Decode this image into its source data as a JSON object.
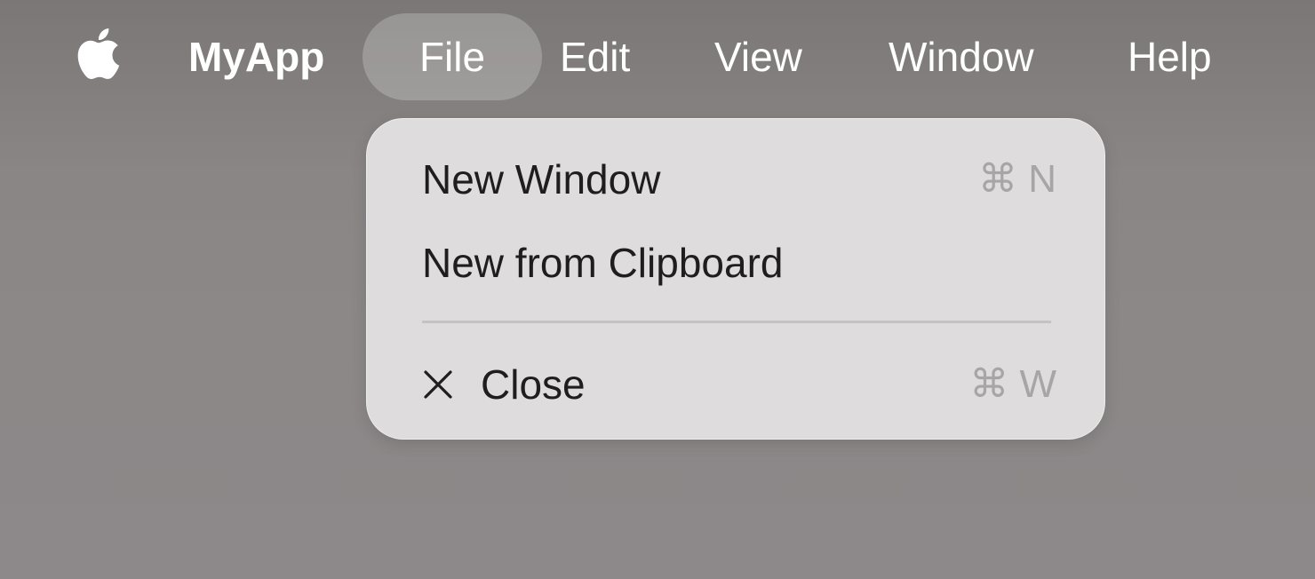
{
  "menubar": {
    "apple_icon": "apple-logo-icon",
    "app_name": "MyApp",
    "menus": [
      "File",
      "Edit",
      "View",
      "Window",
      "Help"
    ],
    "active_menu": "File"
  },
  "dropdown": {
    "items": [
      {
        "label": "New Window",
        "shortcut": "⌘ N",
        "icon": null
      },
      {
        "label": "New from Clipboard",
        "shortcut": "",
        "icon": null
      },
      {
        "label": "Close",
        "shortcut": "⌘ W",
        "icon": "close-icon"
      }
    ],
    "separator_after_index": 1
  },
  "colors": {
    "menu_text": "#ffffff",
    "menu_active_bg": "rgba(255,255,255,0.22)",
    "dropdown_bg": "#dedcdd",
    "item_text": "#1e1e1e",
    "shortcut_text": "#a7a5a6"
  }
}
